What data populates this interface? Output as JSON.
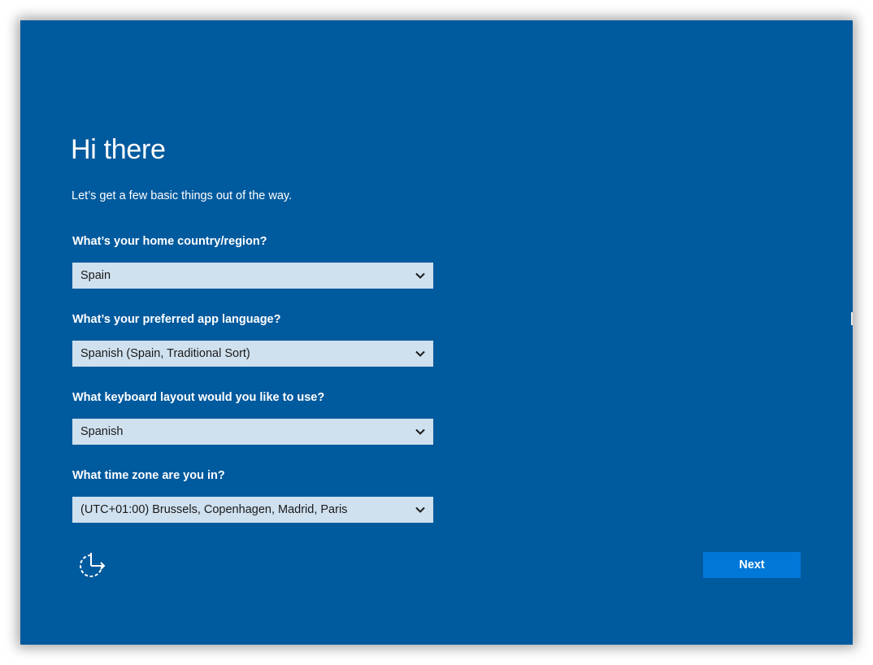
{
  "page": {
    "title": "Hi there",
    "subtitle": "Let’s get a few basic things out of the way."
  },
  "questions": [
    {
      "label": "What’s your home country/region?",
      "value": "Spain"
    },
    {
      "label": "What’s your preferred app language?",
      "value": "Spanish (Spain, Traditional Sort)"
    },
    {
      "label": "What keyboard layout would you like to use?",
      "value": "Spanish"
    },
    {
      "label": "What time zone are you in?",
      "value": "(UTC+01:00) Brussels, Copenhagen, Madrid, Paris"
    }
  ],
  "footer": {
    "next_label": "Next",
    "accessibility_icon": "ease-of-access-icon"
  },
  "colors": {
    "background": "#005a9e",
    "dropdown": "#cfe0ee",
    "button": "#0078d7",
    "text": "#ffffff"
  }
}
